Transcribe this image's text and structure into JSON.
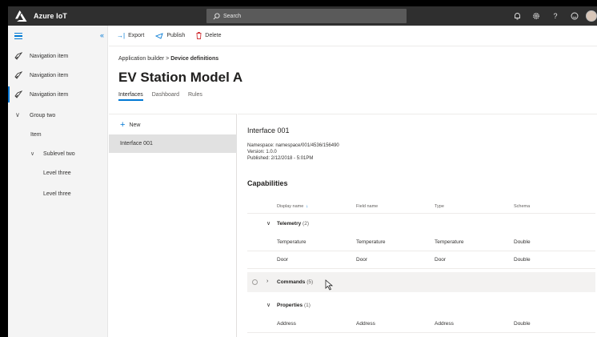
{
  "topbar": {
    "brand": "Azure IoT",
    "search_placeholder": "Search",
    "icons": [
      "bell-icon",
      "gear-icon",
      "help-icon",
      "smiley-icon",
      "avatar"
    ]
  },
  "nav": {
    "items": [
      {
        "label": "Navigation item",
        "icon": "rocket-icon"
      },
      {
        "label": "Navigation item",
        "icon": "rocket-icon"
      },
      {
        "label": "Navigation item",
        "icon": "rocket-icon",
        "selected": true
      }
    ],
    "group": {
      "label": "Group two"
    },
    "item": "Item",
    "sublevel": "Sublevel two",
    "level_three_a": "Level three",
    "level_three_b": "Level three"
  },
  "toolbar": {
    "export_label": "Export",
    "publish_label": "Publish",
    "delete_label": "Delete"
  },
  "breadcrumb": {
    "parent": "Application builder",
    "separator": ">",
    "current": "Device definitions"
  },
  "page": {
    "title": "EV Station Model A",
    "tabs": [
      "Interfaces",
      "Dashboard",
      "Rules"
    ],
    "active_tab": "Interfaces"
  },
  "list": {
    "new_label": "New",
    "items": [
      "Interface 001"
    ]
  },
  "detail": {
    "title": "Interface 001",
    "namespace": "Namespace: namespace/001/4536/156490",
    "version": "Version: 1.0.0",
    "published": "Published: 2/12/2018 - 5:01PM",
    "capabilities_title": "Capabilities",
    "columns": [
      "Display name",
      "Field name",
      "Type",
      "Schema"
    ],
    "telemetry": {
      "label": "Telemetry",
      "count": "(2)",
      "rows": [
        [
          "Temperature",
          "Temperature",
          "Temperature",
          "Double"
        ],
        [
          "Door",
          "Door",
          "Door",
          "Double"
        ]
      ]
    },
    "commands": {
      "label": "Commands",
      "count": "(5)"
    },
    "properties": {
      "label": "Properties",
      "count": "(1)",
      "rows": [
        [
          "Address",
          "Address",
          "Address",
          "Double"
        ]
      ]
    }
  },
  "colors": {
    "accent": "#0078d4",
    "topbar": "#2f2f2f",
    "delete": "#d13438",
    "selected_row": "#e1e1e1"
  }
}
